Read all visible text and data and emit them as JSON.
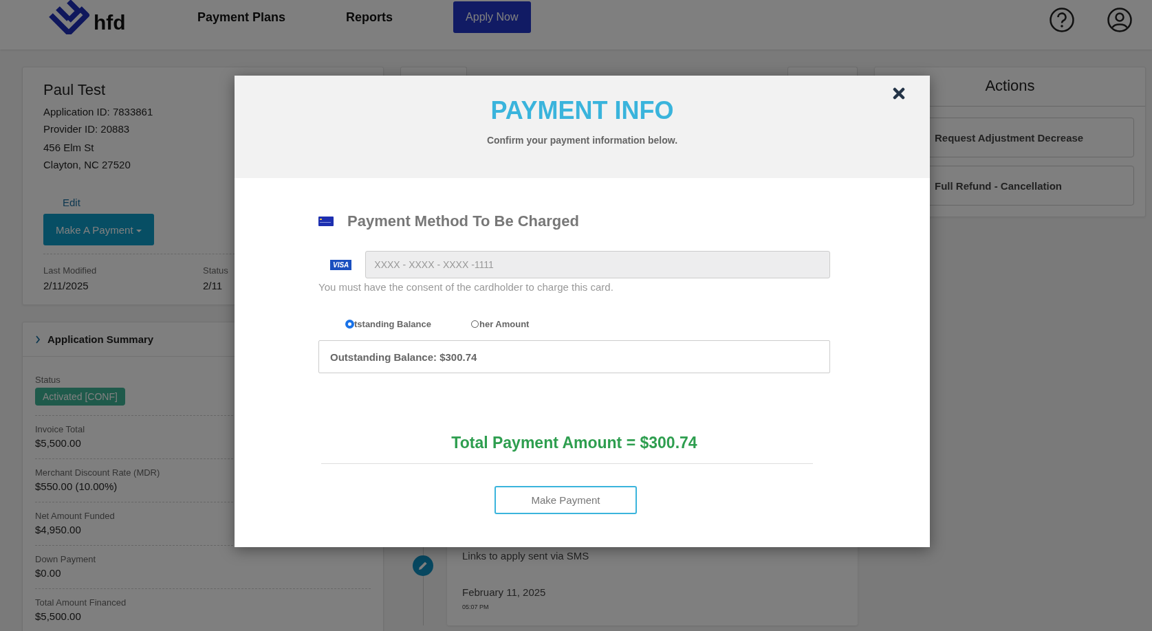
{
  "header": {
    "brand": "hfd",
    "nav": [
      {
        "label": "Payment Plans"
      },
      {
        "label": "Reports"
      }
    ],
    "apply_button": "Apply Now"
  },
  "customer": {
    "name": "Paul Test",
    "ids": [
      "Application ID: 7833861",
      "Provider ID: 20883"
    ],
    "address": [
      "456 Elm St",
      "Clayton, NC 27520"
    ],
    "edit_link": "Edit",
    "payment_button": "Make A Payment",
    "meta": [
      {
        "label": "Last Modified",
        "value": "2/11/2025"
      },
      {
        "label": "Status",
        "value": "2/11"
      }
    ]
  },
  "summary": {
    "title": "Application Summary",
    "fields": [
      {
        "label": "Status",
        "value": "Activated [CONF]",
        "kind": "badge"
      },
      {
        "label": "Invoice Total",
        "value": "$5,500.00",
        "kind": "text"
      },
      {
        "label": "Merchant Discount Rate (MDR)",
        "value": "$550.00 (10.00%)",
        "kind": "text"
      },
      {
        "label": "Net Amount Funded",
        "value": "$4,950.00",
        "kind": "text"
      },
      {
        "label": "Down Payment",
        "value": "$0.00",
        "kind": "text"
      },
      {
        "label": "Total Amount Financed",
        "value": "$5,500.00",
        "kind": "text"
      }
    ]
  },
  "timeline": [
    {
      "text": "Links to apply sent via SMS",
      "date": "February 11, 2025",
      "time": "05:07 PM"
    }
  ],
  "actions": {
    "title": "Actions",
    "buttons": [
      "Request Adjustment Decrease",
      "Full Refund - Cancellation"
    ]
  },
  "modal": {
    "title": "PAYMENT INFO",
    "subtitle": "Confirm your payment information below.",
    "method_heading": "Payment Method To Be Charged",
    "card_brand": "VISA",
    "card_number": "XXXX - XXXX - XXXX -1111",
    "card_disabled": true,
    "consent": "You must have the consent of the cardholder to charge this card.",
    "options": [
      {
        "label": "tstanding Balance",
        "selected": true
      },
      {
        "label": "her Amount",
        "selected": false
      }
    ],
    "balance": "Outstanding Balance: $300.74",
    "total": "Total Payment Amount = $300.74",
    "submit": "Make Payment"
  }
}
